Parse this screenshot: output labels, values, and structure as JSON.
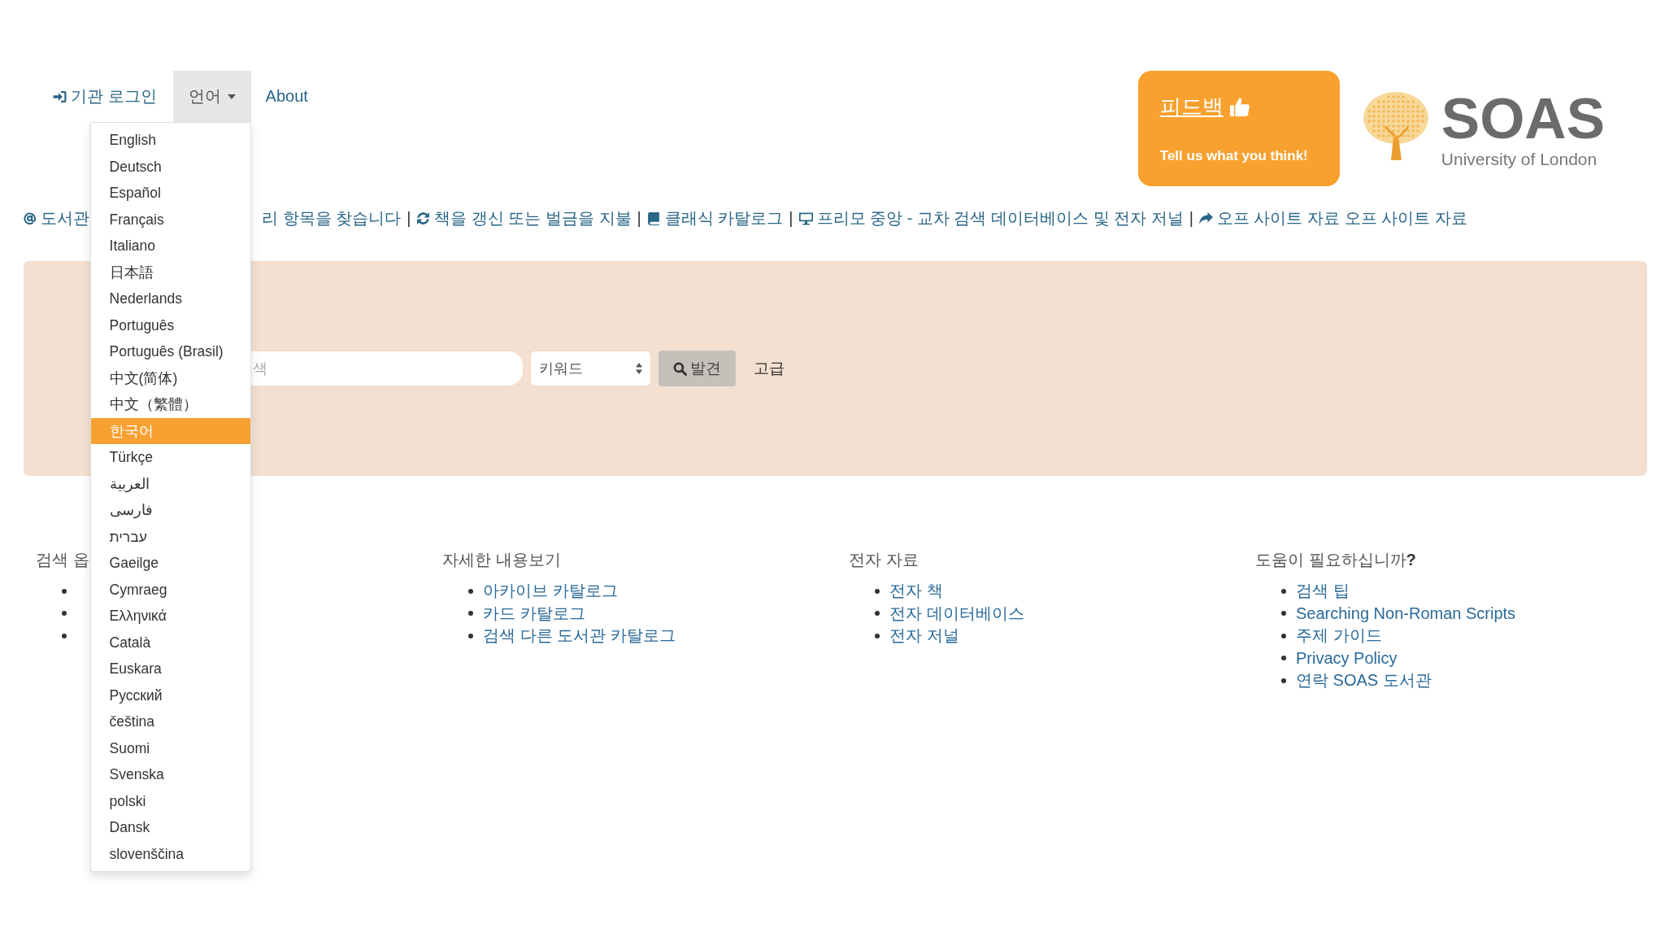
{
  "nav": {
    "login": "기관 로그인",
    "language": {
      "label": "언어",
      "expanded": true,
      "options": [
        {
          "label": "English",
          "selected": false
        },
        {
          "label": "Deutsch",
          "selected": false
        },
        {
          "label": "Español",
          "selected": false
        },
        {
          "label": "Français",
          "selected": false
        },
        {
          "label": "Italiano",
          "selected": false
        },
        {
          "label": "日本語",
          "selected": false
        },
        {
          "label": "Nederlands",
          "selected": false
        },
        {
          "label": "Português",
          "selected": false
        },
        {
          "label": "Português (Brasil)",
          "selected": false
        },
        {
          "label": "中文(简体)",
          "selected": false
        },
        {
          "label": "中文（繁體）",
          "selected": false
        },
        {
          "label": "한국어",
          "selected": true
        },
        {
          "label": "Türkçe",
          "selected": false
        },
        {
          "label": "العربية",
          "selected": false
        },
        {
          "label": "فارسی",
          "selected": false
        },
        {
          "label": "עברית",
          "selected": false
        },
        {
          "label": "Gaeilge",
          "selected": false
        },
        {
          "label": "Cymraeg",
          "selected": false
        },
        {
          "label": "Ελληνικά",
          "selected": false
        },
        {
          "label": "Català",
          "selected": false
        },
        {
          "label": "Euskara",
          "selected": false
        },
        {
          "label": "Русский",
          "selected": false
        },
        {
          "label": "čeština",
          "selected": false
        },
        {
          "label": "Suomi",
          "selected": false
        },
        {
          "label": "Svenska",
          "selected": false
        },
        {
          "label": "polski",
          "selected": false
        },
        {
          "label": "Dansk",
          "selected": false
        },
        {
          "label": "slovenščina",
          "selected": false
        }
      ]
    },
    "about": "About"
  },
  "feedback": {
    "title": "피드백",
    "tagline": "Tell us what you think!"
  },
  "logo": {
    "name": "SOAS",
    "subtitle": "University of London"
  },
  "quick_links": [
    {
      "kind": "at",
      "texts": [
        "도서관",
        "리 항목을 찾습니다"
      ]
    },
    {
      "kind": "separator",
      "text": "|"
    },
    {
      "kind": "refresh",
      "texts": [
        "책을 갱신 또는 벌금을 지불"
      ]
    },
    {
      "kind": "separator",
      "text": "|"
    },
    {
      "kind": "book",
      "texts": [
        "클래식 카탈로그"
      ]
    },
    {
      "kind": "separator",
      "text": "|"
    },
    {
      "kind": "monitor",
      "texts": [
        "프리모 중앙 - 교차 검색 데이터베이스 및 전자 저널"
      ]
    },
    {
      "kind": "separator",
      "text": "|"
    },
    {
      "kind": "share",
      "texts": [
        "오프 사이트 자료 오프 사이트 자료"
      ]
    }
  ],
  "search": {
    "placeholder": "색",
    "scope": "키워드",
    "button": "발견",
    "advanced": "고급"
  },
  "footer": {
    "columns": [
      {
        "heading": "검색 옵",
        "items": [
          {
            "kind": "covered"
          },
          {
            "kind": "covered"
          },
          {
            "kind": "covered"
          }
        ]
      },
      {
        "heading": "자세한 내용보기",
        "items": [
          {
            "kind": "link",
            "text": "아카이브 카탈로그"
          },
          {
            "kind": "link",
            "text": "카드 카탈로그"
          },
          {
            "kind": "link",
            "text": "검색 다른 도서관 카탈로그"
          }
        ]
      },
      {
        "heading": "전자 자료",
        "items": [
          {
            "kind": "link",
            "text": "전자 책"
          },
          {
            "kind": "link",
            "text": "전자 데이터베이스"
          },
          {
            "kind": "link",
            "text": "전자 저널"
          }
        ]
      },
      {
        "heading": "도움이 필요하십니까**?**",
        "items": [
          {
            "kind": "link",
            "text": "검색 팁"
          },
          {
            "kind": "link",
            "text": "Searching Non-Roman Scripts"
          },
          {
            "kind": "link",
            "text": "주제 가이드"
          },
          {
            "kind": "link",
            "text": "Privacy Policy"
          },
          {
            "kind": "link",
            "text": "연락 SOAS 도서관"
          }
        ]
      }
    ]
  }
}
